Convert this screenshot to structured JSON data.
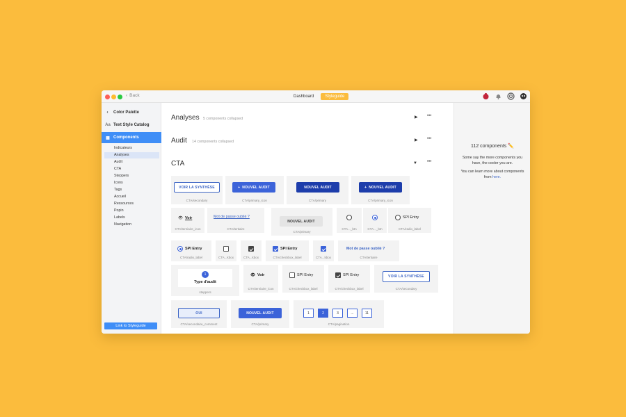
{
  "window": {
    "back_label": "Back",
    "tabs": [
      {
        "label": "Dashboard"
      },
      {
        "label": "Styleguide"
      }
    ]
  },
  "sidebar": {
    "main_items": [
      {
        "label": "Color Palette",
        "icon": "palette-icon"
      },
      {
        "label": "Text Style Catalog",
        "icon": "text-style-icon"
      },
      {
        "label": "Components",
        "icon": "components-icon"
      }
    ],
    "sub_items": [
      {
        "label": "Indicateurs"
      },
      {
        "label": "Analyses"
      },
      {
        "label": "Audit"
      },
      {
        "label": "CTA"
      },
      {
        "label": "Steppers"
      },
      {
        "label": "Icons"
      },
      {
        "label": "Tags"
      },
      {
        "label": "Accueil"
      },
      {
        "label": "Ressources"
      },
      {
        "label": "Popin"
      },
      {
        "label": "Labels"
      },
      {
        "label": "Navigation"
      }
    ],
    "link_label": "Link to Styleguide"
  },
  "sections": [
    {
      "title": "Analyses",
      "subtitle": "5 components collapsed"
    },
    {
      "title": "Audit",
      "subtitle": "14 components collapsed"
    },
    {
      "title": "CTA",
      "subtitle": ""
    }
  ],
  "cta": {
    "row1": [
      {
        "label": "VOIR LA SYNTHÈSE",
        "caption": "CTA/secondary"
      },
      {
        "label": "NOUVEL AUDIT",
        "caption": "CTA/primary_icon"
      },
      {
        "label": "NOUVEL AUDIT",
        "caption": "CTA/primary"
      },
      {
        "label": "NOUVEL AUDIT",
        "caption": "CTA/primary_icon"
      }
    ],
    "row2": [
      {
        "label": "Voir",
        "caption": "CTA/terniaire_icon"
      },
      {
        "label": "Mot de passe oublié ?",
        "caption": "CTA/tertiaire"
      },
      {
        "label": "NOUVEL AUDIT",
        "caption": "CTA/primary"
      },
      {
        "caption": "CTA..._btn"
      },
      {
        "caption": "CTA..._btn"
      },
      {
        "label": "SPI Entry",
        "caption": "CTA/radio_label"
      }
    ],
    "row3": [
      {
        "label": "SPI Entry",
        "caption": "CTA/radio_label"
      },
      {
        "caption": "CTA...kbox"
      },
      {
        "caption": "CTA...kbox"
      },
      {
        "label": "SPI Entry",
        "caption": "CTA/checkbox_label"
      },
      {
        "caption": "CTA...kbox"
      },
      {
        "label": "Mot de passe oublié ?",
        "caption": "CTA/tertiaire"
      }
    ],
    "row4": [
      {
        "step": "1",
        "label": "Type d'audit",
        "caption": "steppers"
      },
      {
        "label": "Voir",
        "caption": "CTA/terniaire_icon"
      },
      {
        "label": "SPI Entry",
        "caption": "CTA/checkbox_label"
      },
      {
        "label": "SPI Entry",
        "caption": "CTA/checkbox_label"
      },
      {
        "label": "VOIR LA SYNTHÈSE",
        "caption": "CTA/secondary"
      }
    ],
    "row5": [
      {
        "label": "OUI",
        "caption": "CTA/secondaire_comment"
      },
      {
        "label": "NOUVEL AUDIT",
        "caption": "CTA/primary"
      },
      {
        "pages": [
          "1",
          "2",
          "3",
          "...",
          "11"
        ],
        "caption": "CTA/pagination"
      }
    ]
  },
  "right_panel": {
    "count": "112 components ✏️",
    "text1": "Some say the more components you have, the cooler you are.",
    "text2": "You can learn more about components from",
    "link": "here."
  },
  "colors": {
    "background": "#FBBC3D",
    "accent": "#3F8EF7",
    "brand_blue": "#2C51C4"
  }
}
